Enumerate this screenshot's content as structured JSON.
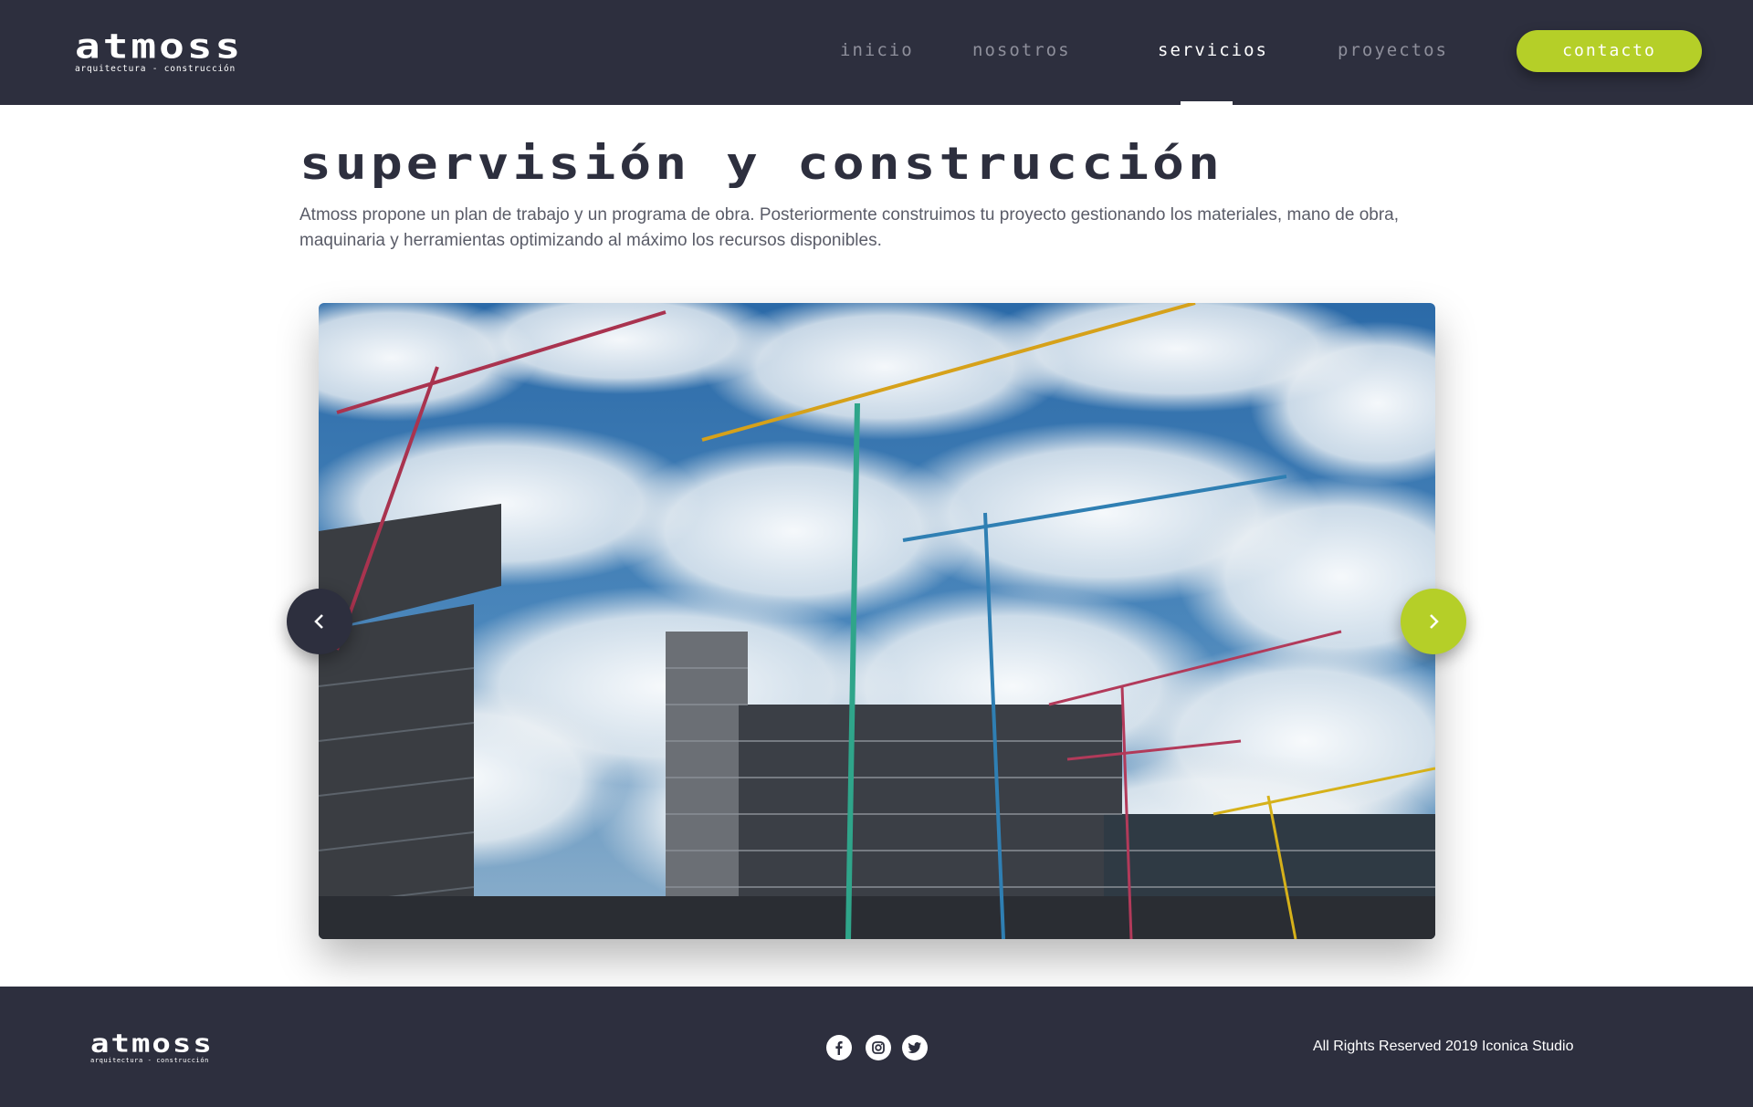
{
  "brand": {
    "name": "atmoss",
    "tagline": "arquitectura - construcción",
    "colors": {
      "primary": "#2d2f3e",
      "accent": "#b5cf28",
      "text": "#5a5c68"
    }
  },
  "nav": {
    "items": [
      {
        "label": "inicio",
        "active": false
      },
      {
        "label": "nosotros",
        "active": false
      },
      {
        "label": "servicios",
        "active": true
      },
      {
        "label": "proyectos",
        "active": false
      }
    ],
    "contact_label": "contacto"
  },
  "main": {
    "title": "supervisión y construcción",
    "description": "Atmoss propone un plan de trabajo y un programa de obra. Posteriormente construimos tu proyecto gestionando los materiales, mano de obra, maquinaria y herramientas optimizando al máximo los recursos disponibles.",
    "slider": {
      "image": "construction-cranes-photo",
      "prev_icon": "chevron-left-icon",
      "next_icon": "chevron-right-icon"
    }
  },
  "footer": {
    "social": [
      {
        "icon": "facebook-icon"
      },
      {
        "icon": "instagram-icon"
      },
      {
        "icon": "twitter-icon"
      }
    ],
    "copyright": "All Rights Reserved 2019 Iconica Studio"
  }
}
